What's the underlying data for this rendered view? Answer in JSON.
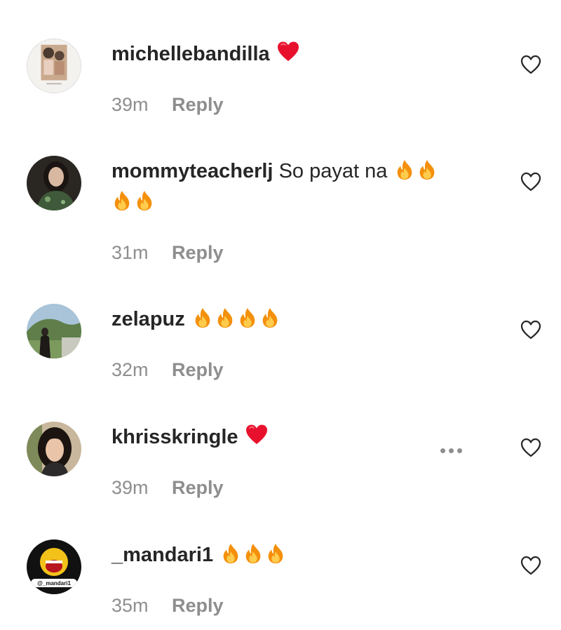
{
  "comments": [
    {
      "username": "michellebandilla",
      "text": "",
      "emojis": [
        "red-heart"
      ],
      "time": "39m",
      "reply_label": "Reply"
    },
    {
      "username": "mommyteacherlj",
      "text": "So payat na",
      "emojis_line1": [
        "fire",
        "fire"
      ],
      "emojis_line2": [
        "fire",
        "fire"
      ],
      "time": "31m",
      "reply_label": "Reply"
    },
    {
      "username": "zelapuz",
      "text": "",
      "emojis": [
        "fire",
        "fire",
        "fire",
        "fire"
      ],
      "time": "32m",
      "reply_label": "Reply"
    },
    {
      "username": "khrisskringle",
      "text": "",
      "emojis": [
        "red-heart"
      ],
      "time": "39m",
      "reply_label": "Reply",
      "has_more_menu": true
    },
    {
      "username": "_mandari1",
      "text": "",
      "emojis": [
        "fire",
        "fire",
        "fire"
      ],
      "time": "35m",
      "reply_label": "Reply",
      "avatar_label": "@_mandari1"
    }
  ],
  "colors": {
    "text": "#262626",
    "secondary": "#8e8e8e",
    "heart_emoji": "#e8112d",
    "fire_outer": "#f4900c",
    "fire_inner": "#ffcc4d"
  }
}
